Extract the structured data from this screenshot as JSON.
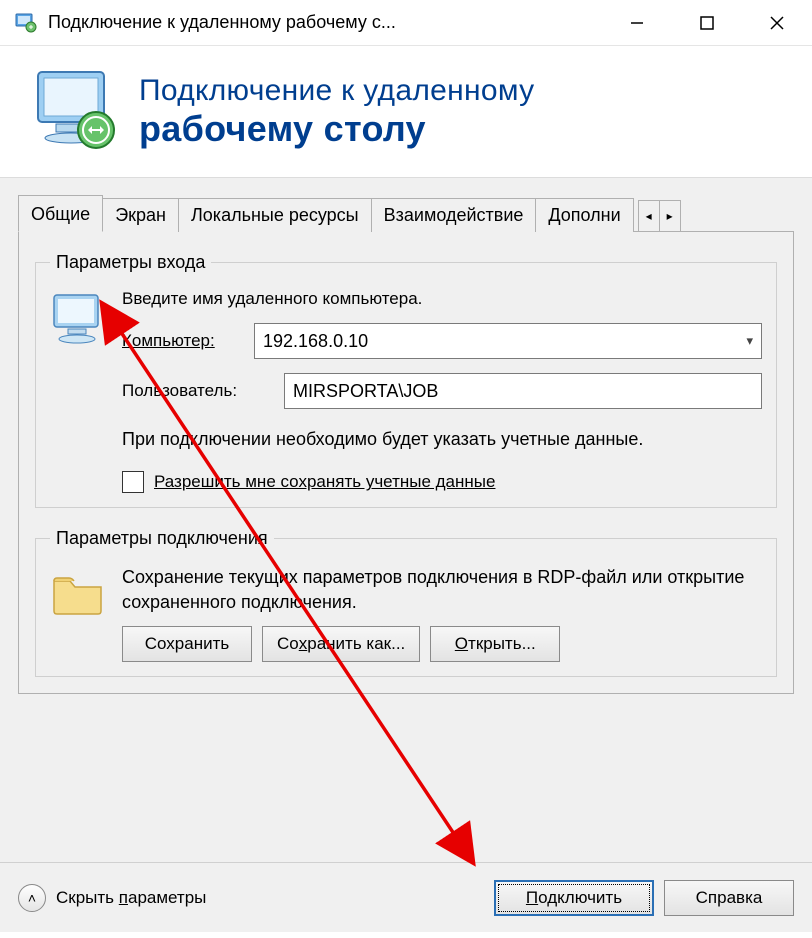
{
  "window": {
    "title": "Подключение к удаленному рабочему с..."
  },
  "banner": {
    "line1": "Подключение к удаленному",
    "line2": "рабочему столу"
  },
  "tabs": {
    "items": [
      {
        "label": "Общие"
      },
      {
        "label": "Экран"
      },
      {
        "label": "Локальные ресурсы"
      },
      {
        "label": "Взаимодействие"
      },
      {
        "label": "Дополни"
      }
    ]
  },
  "login_group": {
    "legend": "Параметры входа",
    "instruction": "Введите имя удаленного компьютера.",
    "computer_label": "Компьютер:",
    "computer_value": "192.168.0.10",
    "user_label": "Пользователь:",
    "user_value": "MIRSPORTA\\JOB",
    "note": "При подключении необходимо будет указать учетные данные.",
    "remember_label": "Разрешить мне сохранять учетные данные"
  },
  "conn_group": {
    "legend": "Параметры подключения",
    "note": "Сохранение текущих параметров подключения в RDP-файл или открытие сохраненного подключения.",
    "save": "Сохранить",
    "save_as_prefix": "Со",
    "save_as_ul": "х",
    "save_as_suffix": "ранить как...",
    "open_ul": "О",
    "open_suffix": "ткрыть..."
  },
  "bottom": {
    "hide_prefix": "Скрыть ",
    "hide_ul": "п",
    "hide_suffix": "араметры",
    "connect_ul": "П",
    "connect_suffix": "одключить",
    "help": "Справка"
  }
}
